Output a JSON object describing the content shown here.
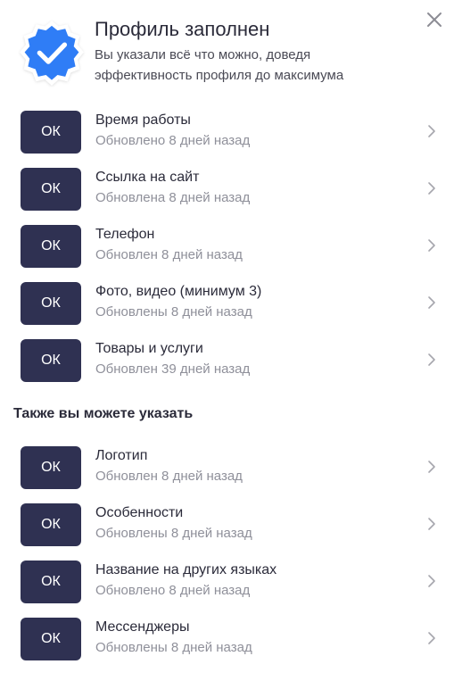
{
  "header": {
    "title": "Профиль заполнен",
    "subtitle": "Вы указали всё что можно, доведя\nэффективность профиля до максимума"
  },
  "icons": {
    "badge": "verified-check-icon",
    "close": "close-icon",
    "chevron": "chevron-right-icon"
  },
  "colors": {
    "badge": "#2f7df6",
    "button": "#2f3152",
    "subtext": "#8f909a"
  },
  "completed_items": [
    {
      "button": "ОК",
      "title": "Время работы",
      "status": "Обновлено 8 дней назад"
    },
    {
      "button": "ОК",
      "title": "Ссылка на сайт",
      "status": "Обновлена 8 дней назад"
    },
    {
      "button": "ОК",
      "title": "Телефон",
      "status": "Обновлен 8 дней назад"
    },
    {
      "button": "ОК",
      "title": "Фото, видео (минимум 3)",
      "status": "Обновлены 8 дней назад"
    },
    {
      "button": "ОК",
      "title": "Товары и услуги",
      "status": "Обновлен 39 дней назад"
    }
  ],
  "optional_section": {
    "heading": "Также вы можете указать",
    "items": [
      {
        "button": "ОК",
        "title": "Логотип",
        "status": "Обновлен 8 дней назад"
      },
      {
        "button": "ОК",
        "title": "Особенности",
        "status": "Обновлены 8 дней назад"
      },
      {
        "button": "ОК",
        "title": "Название на других языках",
        "status": "Обновлено 8 дней назад"
      },
      {
        "button": "ОК",
        "title": "Мессенджеры",
        "status": "Обновлены 8 дней назад"
      }
    ]
  }
}
